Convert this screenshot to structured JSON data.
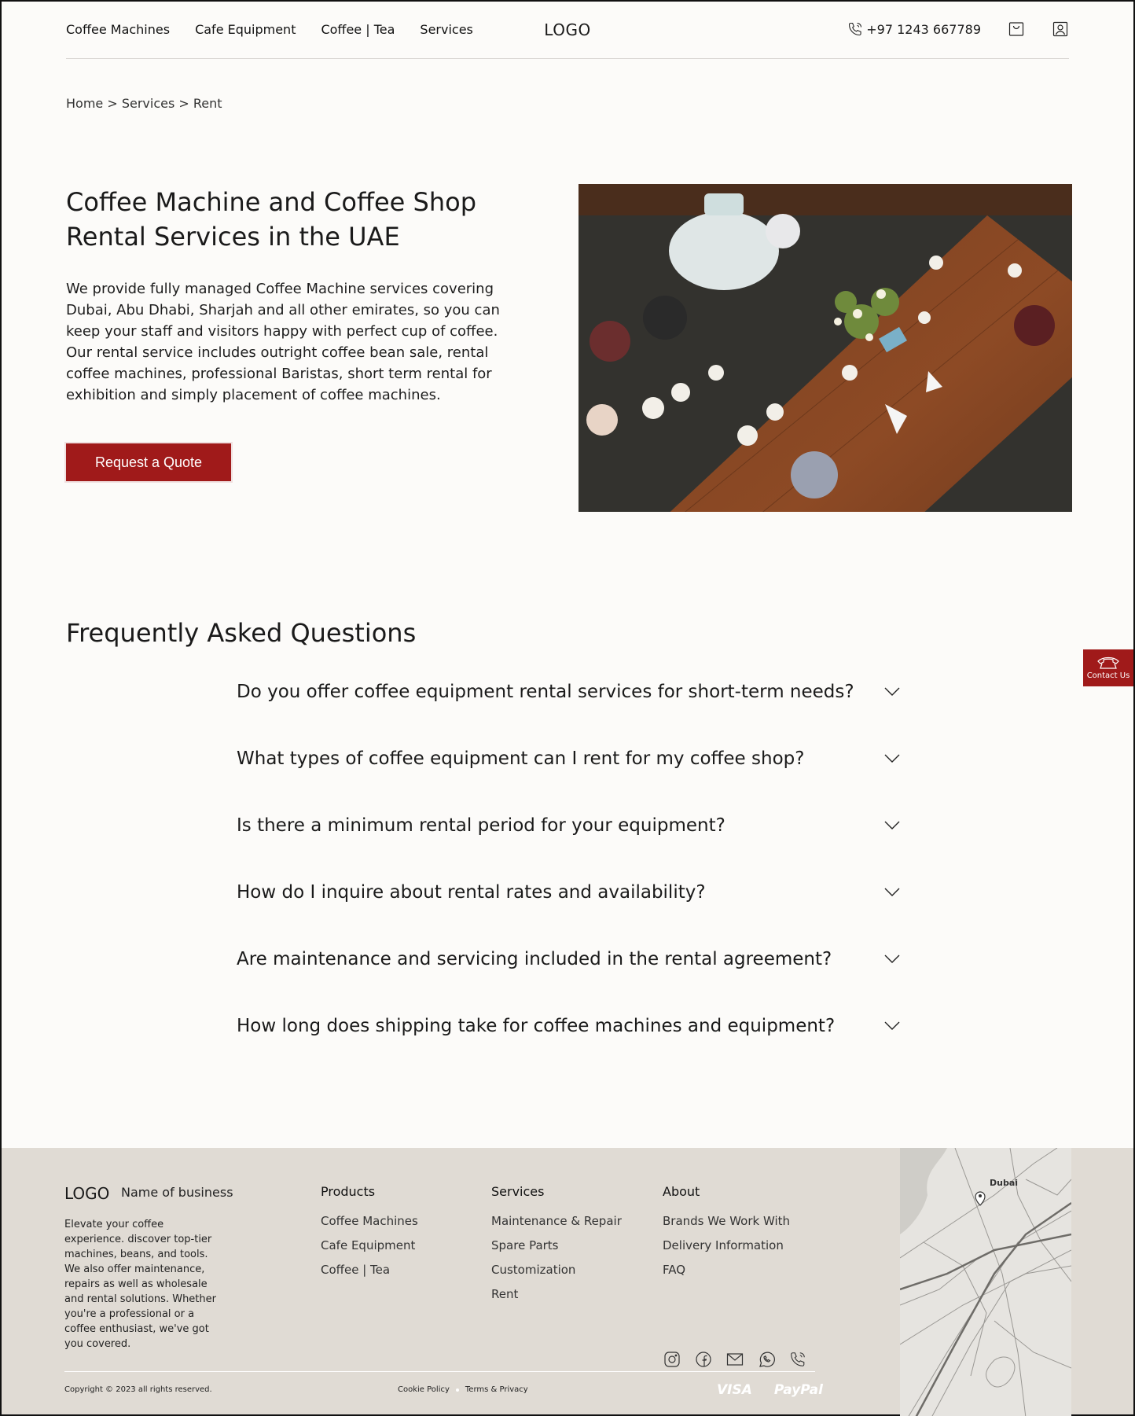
{
  "header": {
    "nav": [
      "Coffee Machines",
      "Cafe Equipment",
      "Coffee | Tea",
      "Services"
    ],
    "logo": "LOGO",
    "phone": "+97 1243 667789"
  },
  "breadcrumb": "Home > Services > Rent",
  "hero": {
    "title": "Coffee Machine and Coffee Shop Rental Services in the UAE",
    "text": "We provide fully managed Coffee Machine services covering Dubai, Abu Dhabi, Sharjah and all other emirates, so you can keep your staff and visitors happy with perfect cup of coffee. Our rental service includes outright coffee bean sale, rental coffee machines, professional Baristas, short term rental for exhibition and simply placement of coffee machines.",
    "button": "Request a Quote"
  },
  "faq": {
    "title": "Frequently Asked Questions",
    "items": [
      "Do you offer coffee equipment rental services for short-term needs?",
      "What types of coffee equipment can I rent for my coffee shop?",
      "Is there a minimum rental period for your equipment?",
      "How do I inquire about rental rates and availability?",
      "Are maintenance and servicing included in the rental agreement?",
      "How long does shipping take for coffee machines and equipment?"
    ]
  },
  "contact_tab": "Contact Us",
  "footer": {
    "logo": "LOGO",
    "business_name": "Name of business",
    "description": "Elevate your coffee experience. discover top-tier machines, beans, and tools. We also offer maintenance, repairs as well as wholesale and rental solutions. Whether you're a professional or a coffee enthusiast, we've got you covered.",
    "columns": [
      {
        "title": "Products",
        "links": [
          "Coffee Machines",
          "Cafe Equipment",
          "Coffee | Tea"
        ]
      },
      {
        "title": "Services",
        "links": [
          "Maintenance & Repair",
          "Spare Parts",
          "Customization",
          "Rent"
        ]
      },
      {
        "title": "About",
        "links": [
          "Brands We Work With",
          "Delivery Information",
          "FAQ"
        ]
      }
    ],
    "copyright": "Copyright © 2023 all rights reserved.",
    "cookie": "Cookie Policy",
    "terms": "Terms & Privacy",
    "payments": [
      "VISA",
      "PayPal"
    ],
    "map_label": "Dubai"
  }
}
